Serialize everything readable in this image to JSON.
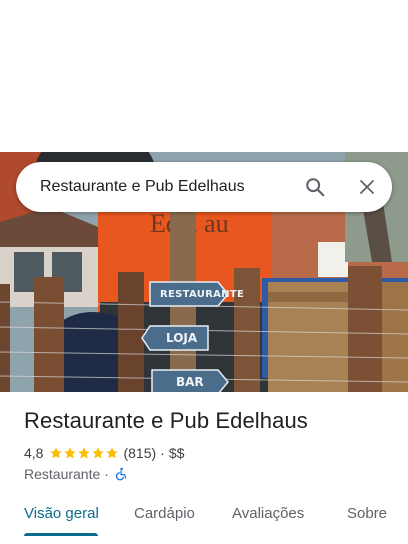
{
  "search": {
    "query": "Restaurante e Pub Edelhaus",
    "search_icon": "search-icon",
    "close_icon": "close-icon"
  },
  "hero": {
    "signs": [
      "RESTAURANTE",
      "LOJA",
      "BAR"
    ]
  },
  "place": {
    "name": "Restaurante e Pub Edelhaus",
    "rating": "4,8",
    "stars": 5,
    "reviews": "(815)",
    "separator": "·",
    "price": "$$",
    "category": "Restaurante",
    "category_separator": "·",
    "accessibility_icon": "wheelchair-icon"
  },
  "tabs": [
    {
      "label": "Visão geral",
      "active": true
    },
    {
      "label": "Cardápio",
      "active": false
    },
    {
      "label": "Avaliações",
      "active": false
    },
    {
      "label": "Sobre",
      "active": false
    }
  ],
  "colors": {
    "accent": "#0b6b8a",
    "star": "#fbbc04"
  }
}
